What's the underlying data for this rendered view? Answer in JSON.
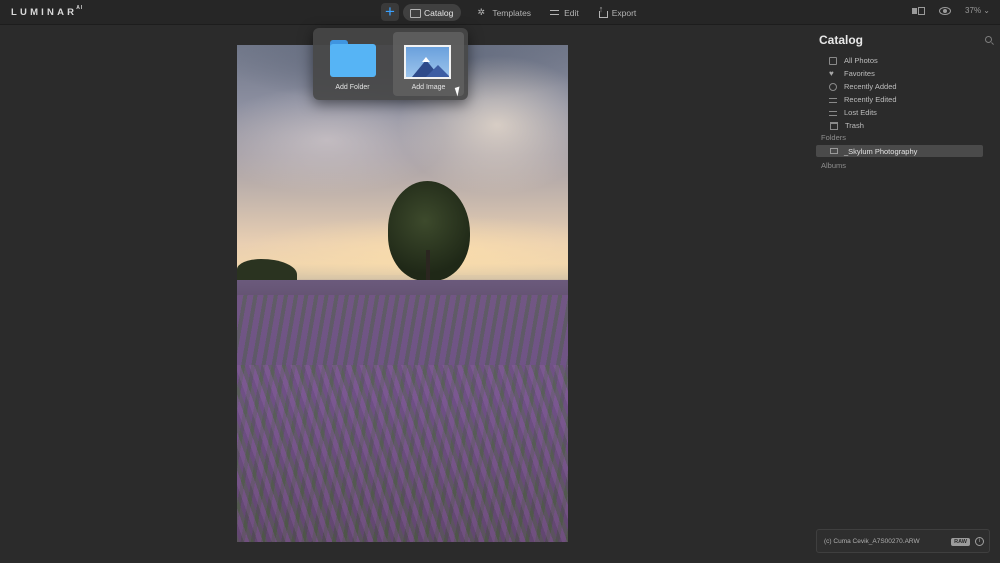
{
  "app": {
    "logo": "LUMINAR",
    "logo_suffix": "AI"
  },
  "topbar": {
    "add_button_symbol": "+",
    "tabs": [
      {
        "label": "Catalog",
        "icon": "folder-icon",
        "active": true
      },
      {
        "label": "Templates",
        "icon": "templates-icon",
        "active": false
      },
      {
        "label": "Edit",
        "icon": "edit-icon",
        "active": false
      },
      {
        "label": "Export",
        "icon": "export-icon",
        "active": false
      }
    ],
    "zoom": "37%",
    "zoom_caret": "⌄"
  },
  "add_menu": {
    "options": [
      {
        "label": "Add Folder",
        "icon": "folder-icon"
      },
      {
        "label": "Add Image",
        "icon": "image-icon",
        "hovered": true
      }
    ]
  },
  "panel": {
    "title": "Catalog",
    "catalog_items": [
      {
        "label": "All Photos",
        "icon": "photos-icon"
      },
      {
        "label": "Favorites",
        "icon": "heart-icon"
      },
      {
        "label": "Recently Added",
        "icon": "clock-icon"
      },
      {
        "label": "Recently Edited",
        "icon": "sliders-icon"
      },
      {
        "label": "Lost Edits",
        "icon": "sliders-icon"
      },
      {
        "label": "Trash",
        "icon": "trash-icon"
      }
    ],
    "folders_label": "Folders",
    "folders": [
      {
        "label": "_Skylum Photography",
        "selected": true
      }
    ],
    "albums_label": "Albums"
  },
  "file_info": {
    "filename": "(c) Cuma Cevik_A7S00270.ARW",
    "badge": "RAW",
    "info_symbol": "i"
  },
  "colors": {
    "accent": "#3aa1ff",
    "background": "#2b2b2b",
    "selected_row": "#4a4a4a"
  }
}
